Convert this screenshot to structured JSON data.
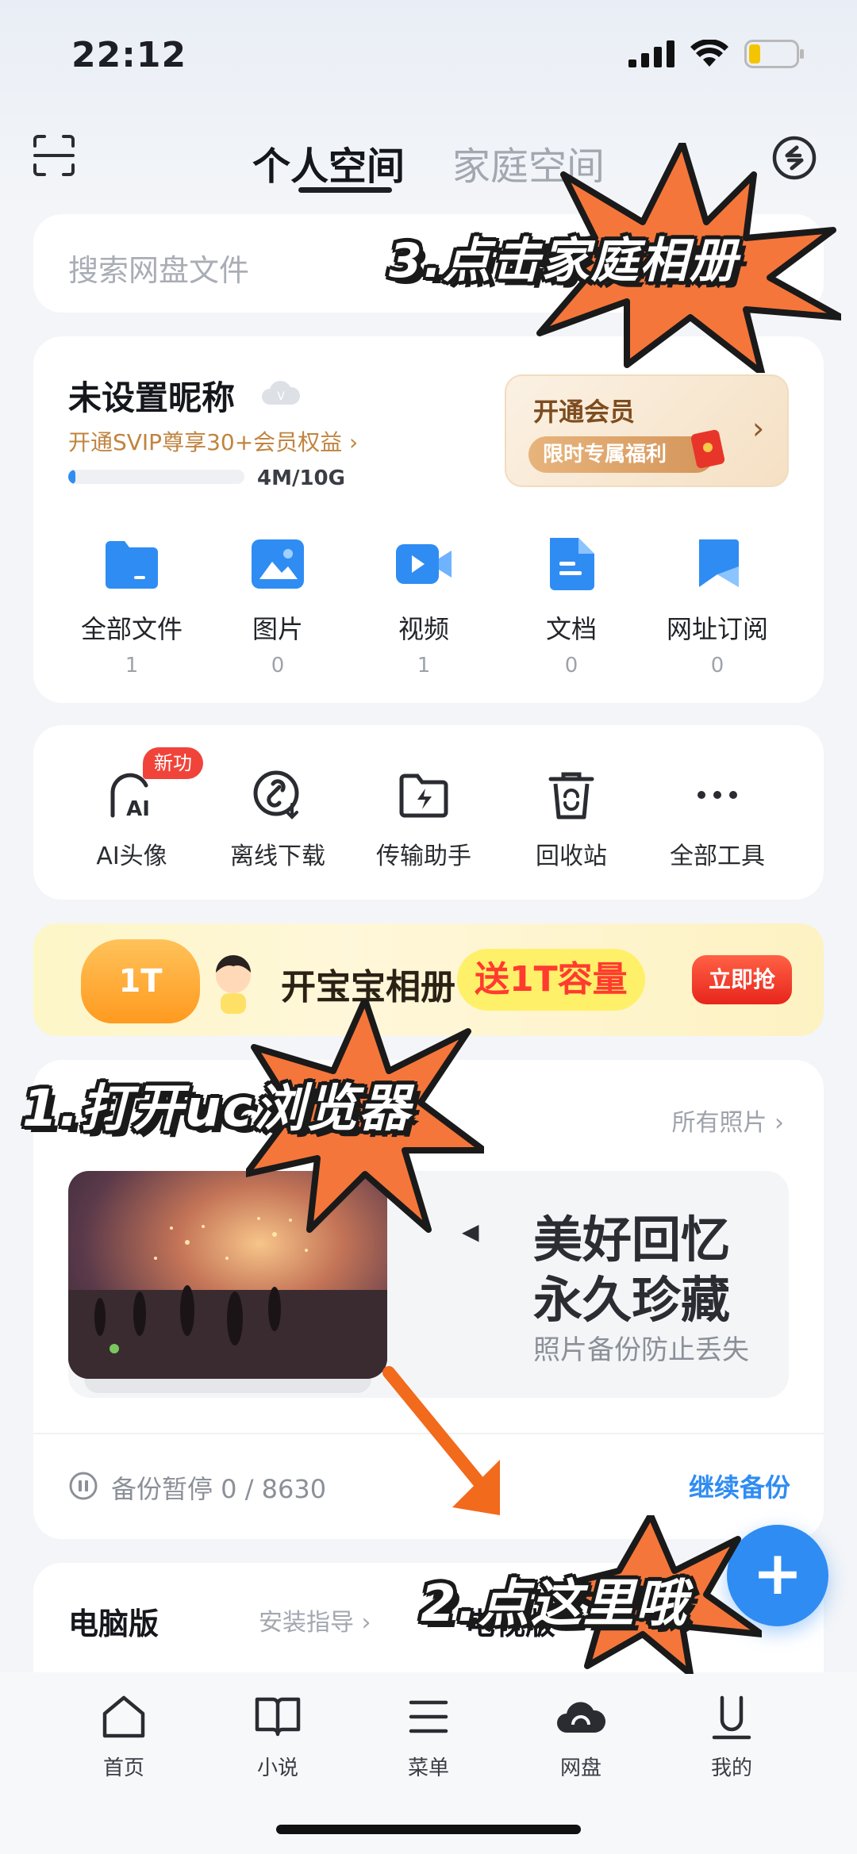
{
  "status_bar": {
    "time": "22:12"
  },
  "top_tabs": {
    "active": "个人空间",
    "inactive": "家庭空间"
  },
  "search": {
    "placeholder": "搜索网盘文件"
  },
  "profile": {
    "nickname": "未设置昵称",
    "svip_link": "开通SVIP尊享30+会员权益 ›",
    "storage_used": "4M/10G",
    "storage_fraction": 0.04,
    "vip_title": "开通会员",
    "vip_chip": "限时专属福利",
    "vip_arrow": "›"
  },
  "categories": [
    {
      "label": "全部文件",
      "count": "1",
      "icon": "folder-icon"
    },
    {
      "label": "图片",
      "count": "0",
      "icon": "image-icon"
    },
    {
      "label": "视频",
      "count": "1",
      "icon": "video-icon"
    },
    {
      "label": "文档",
      "count": "0",
      "icon": "document-icon"
    },
    {
      "label": "网址订阅",
      "count": "0",
      "icon": "bookmark-icon"
    }
  ],
  "tools": [
    {
      "label": "AI头像",
      "badge": "新功能",
      "icon": "ai-avatar-icon"
    },
    {
      "label": "离线下载",
      "icon": "offline-download-icon"
    },
    {
      "label": "传输助手",
      "icon": "transfer-icon"
    },
    {
      "label": "回收站",
      "icon": "recycle-bin-icon"
    },
    {
      "label": "全部工具",
      "icon": "more-icon"
    }
  ],
  "banner": {
    "badge": "1T",
    "text1": "开宝宝相册",
    "text2": "送1T容量",
    "button": "立即抢"
  },
  "photos": {
    "all_link": "所有照片 ›",
    "line1": "美好回忆",
    "line2": "永久珍藏",
    "subtitle": "照片备份防止丢失",
    "play_mark": "◀",
    "backup_status": "备份暂停 0 / 8630",
    "resume": "继续备份"
  },
  "desktop": {
    "title": "电脑版",
    "install_guide": "安装指导 ›",
    "tv_title": "电视版"
  },
  "fab": {
    "label": "+"
  },
  "bottom_nav": [
    {
      "label": "首页",
      "icon": "home-icon"
    },
    {
      "label": "小说",
      "icon": "book-icon"
    },
    {
      "label": "菜单",
      "icon": "menu-icon"
    },
    {
      "label": "网盘",
      "icon": "cloud-icon"
    },
    {
      "label": "我的",
      "icon": "profile-icon"
    }
  ],
  "annotations": {
    "step1": "1.打开uc浏览器",
    "step2": "2.点这里哦",
    "step3": "3.点击家庭相册"
  },
  "colors": {
    "accent": "#2f8cf3",
    "burst": "#f5763a",
    "gold": "#c0843f"
  }
}
